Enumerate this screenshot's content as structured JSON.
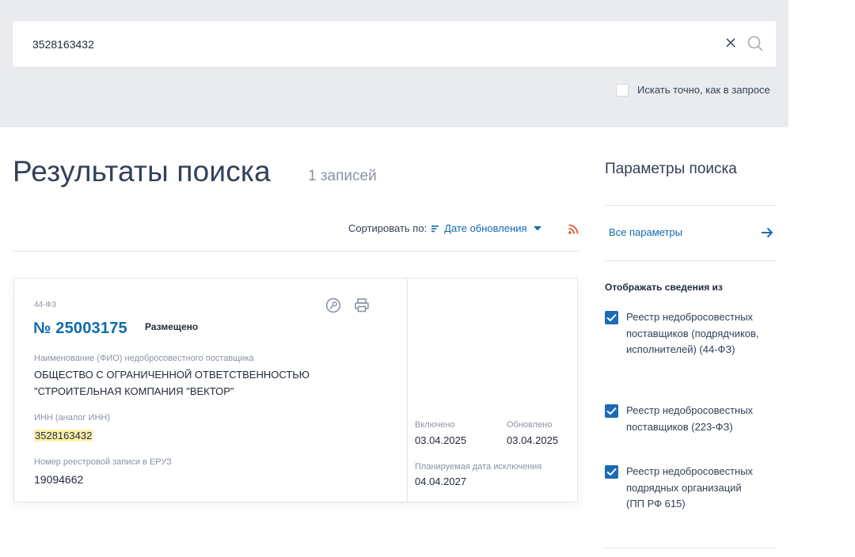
{
  "search": {
    "value": "3528163432",
    "exact_label": "Искать точно, как в запросе"
  },
  "results": {
    "title": "Результаты поиска",
    "count": "1 записей"
  },
  "sort": {
    "label": "Сортировать по:",
    "value": "Дате обновления"
  },
  "card": {
    "law": "44-ФЗ",
    "number": "№ 25003175",
    "status": "Размещено",
    "name_label": "Наименование (ФИО) недобросовестного поставщика",
    "name_value": "ОБЩЕСТВО С ОГРАНИЧЕННОЙ ОТВЕТСТВЕННОСТЬЮ \"СТРОИТЕЛЬНАЯ КОМПАНИЯ \"ВЕКТОР\"",
    "inn_label": "ИНН (аналог ИНН)",
    "inn_value": "3528163432",
    "eruz_label": "Номер реестровой записи в ЕРУЗ",
    "eruz_value": "19094662",
    "included_label": "Включено",
    "included_value": "03.04.2025",
    "updated_label": "Обновлено",
    "updated_value": "03.04.2025",
    "exclusion_label": "Планируемая дата исключения",
    "exclusion_value": "04.04.2027"
  },
  "sidebar": {
    "title": "Параметры поиска",
    "all_params": "Все параметры",
    "show_title": "Отображать сведения из",
    "registries": [
      {
        "label": "Реестр недобросовестных поставщиков (подрядчиков, исполнителей) (44-ФЗ)",
        "checked": true
      },
      {
        "label": "Реестр недобросовестных поставщиков (223-ФЗ)",
        "checked": true
      },
      {
        "label": "Реестр недобросовестных подрядных организаций (ПП РФ 615)",
        "checked": true
      }
    ]
  },
  "colors": {
    "accent": "#0f6bb0",
    "checkbox": "#1c6bb5",
    "highlight": "#fff1a8",
    "rss": "#e2562c"
  },
  "icons": [
    "clear-icon",
    "search-icon",
    "sort-icon",
    "chevron-down-icon",
    "rss-icon",
    "pin-icon",
    "print-icon",
    "arrow-right-icon",
    "check-icon"
  ]
}
